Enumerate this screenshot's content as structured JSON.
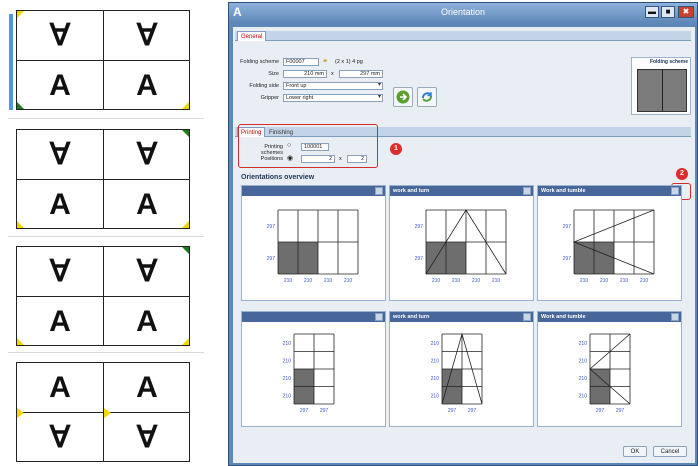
{
  "left_panel": {
    "sheets": [
      {
        "top": [
          "∀",
          "∀"
        ],
        "bottom": [
          "A",
          "A"
        ],
        "selected": true
      },
      {
        "top": [
          "∀",
          "∀"
        ],
        "bottom": [
          "A",
          "A"
        ],
        "selected": false
      },
      {
        "top": [
          "∀",
          "∀"
        ],
        "bottom": [
          "A",
          "A"
        ],
        "selected": false
      },
      {
        "top": [
          "A",
          "A"
        ],
        "bottom": [
          "∀",
          "∀"
        ],
        "selected": false
      }
    ],
    "marker_colors": {
      "yellow": "#f2d600",
      "green": "#1f7a1f"
    }
  },
  "dialog": {
    "app_icon": "A",
    "title": "Orientation",
    "window_buttons": {
      "minimize": "▬",
      "maximize": "■",
      "close": "✖"
    },
    "main_tab": "General",
    "fields": {
      "folding_scheme": {
        "label": "Folding scheme",
        "value": "F00007",
        "extra": "(2 x 1) 4 pg"
      },
      "size": {
        "label": "Size",
        "width": "210 mm",
        "sep": "x",
        "height": "297 mm"
      },
      "folding_side": {
        "label": "Folding side",
        "value": "Front up"
      },
      "gripper": {
        "label": "Gripper",
        "value": "Lower right"
      }
    },
    "folding_scheme_preview_title": "Folding scheme",
    "sub_tabs": [
      "Printing",
      "Finishing"
    ],
    "printing_schemes": {
      "label": "Printing schemes",
      "value": "100001"
    },
    "positions": {
      "label": "Positions",
      "a": "2",
      "sep": "x",
      "b": "2"
    },
    "badges": [
      "1",
      "2"
    ],
    "overview_title": "Orientations overview",
    "cards": [
      {
        "title": "",
        "kind": "plain",
        "rows": 2,
        "row_labels": [
          "297",
          "297"
        ],
        "col_labels": [
          "210",
          "210",
          "210",
          "210"
        ]
      },
      {
        "title": "work and turn",
        "kind": "turn",
        "rows": 2,
        "row_labels": [
          "297",
          "297"
        ],
        "col_labels": [
          "210",
          "210",
          "210",
          "210"
        ]
      },
      {
        "title": "Work and tumble",
        "kind": "tumble",
        "rows": 2,
        "row_labels": [
          "297",
          "297"
        ],
        "col_labels": [
          "210",
          "210",
          "210",
          "210"
        ]
      },
      {
        "title": "",
        "kind": "plain",
        "rows": 4,
        "row_labels": [
          "210",
          "210",
          "210",
          "210"
        ],
        "col_labels": [
          "297",
          "297"
        ]
      },
      {
        "title": "work and turn",
        "kind": "turn",
        "rows": 4,
        "row_labels": [
          "210",
          "210",
          "210",
          "210"
        ],
        "col_labels": [
          "297",
          "297"
        ]
      },
      {
        "title": "Work and tumble",
        "kind": "tumble",
        "rows": 4,
        "row_labels": [
          "210",
          "210",
          "210",
          "210"
        ],
        "col_labels": [
          "297",
          "297"
        ]
      }
    ],
    "buttons": {
      "ok": "OK",
      "cancel": "Cancel"
    },
    "colors": {
      "title_bar": "#5d87b8",
      "card_header": "#47679a",
      "highlight": "#d62b2b",
      "dim_label": "#3a56c4",
      "shade": "#6e6e6e"
    }
  }
}
